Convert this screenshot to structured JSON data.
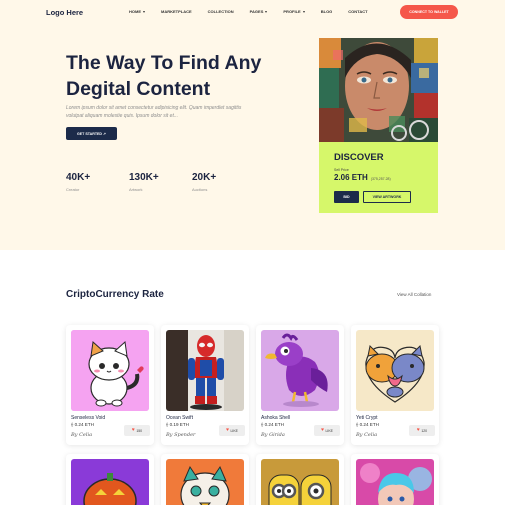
{
  "header": {
    "logo": "Logo Here",
    "nav": [
      {
        "label": "HOME",
        "dropdown": true
      },
      {
        "label": "MARKETPLACE",
        "dropdown": false
      },
      {
        "label": "COLLECTION",
        "dropdown": false
      },
      {
        "label": "PAGES",
        "dropdown": true
      },
      {
        "label": "PROFILE",
        "dropdown": true
      },
      {
        "label": "BLOG",
        "dropdown": false
      },
      {
        "label": "CONTACT",
        "dropdown": false
      }
    ],
    "connect_button": "CONNECT TO WALLET"
  },
  "hero": {
    "title_line1": "The Way To Find Any",
    "title_line2": "Degital Content",
    "text": "Lorem ipsum dolor sit amet consectetur adipisicing elit. Quam imperdiet sagittis volutpat aliquam molestie quis. Ipsum dolor sit et...",
    "start_button": "GET STARTED ↗",
    "stats": [
      {
        "value": "40K+",
        "label": "Creator"
      },
      {
        "value": "130K+",
        "label": "Artwork"
      },
      {
        "value": "20K+",
        "label": "Auctions"
      }
    ],
    "card": {
      "heading": "DISCOVER",
      "sell_label": "Sell Price",
      "price": "2.06 ETH",
      "price_usd": "(375,257.28)",
      "bid_button": "BID",
      "view_button": "VIEW ARTWORK"
    }
  },
  "section": {
    "title": "CriptoCurrency Rate",
    "view_all": "View All Collation"
  },
  "cards": [
    {
      "name": "Senseless Void",
      "price": "0.24 ETH",
      "by": "By Celia",
      "like": "150"
    },
    {
      "name": "Ocean Swift",
      "price": "0.19 ETH",
      "by": "By Spender",
      "like": "LIKE"
    },
    {
      "name": "Ashoka Shell",
      "price": "0.24 ETH",
      "by": "By Girida",
      "like": "LIKE"
    },
    {
      "name": "Yeti Crypt",
      "price": "0.24 ETH",
      "by": "By Celia",
      "like": "120"
    }
  ],
  "icons": {
    "caret": "chevron-down-icon",
    "eth": "eth-icon",
    "heart": "heart-icon"
  },
  "colors": {
    "accent": "#f5574a",
    "navy": "#1c2b4a",
    "lime": "#d6f76a",
    "hero_bg": "#fff8e9"
  }
}
